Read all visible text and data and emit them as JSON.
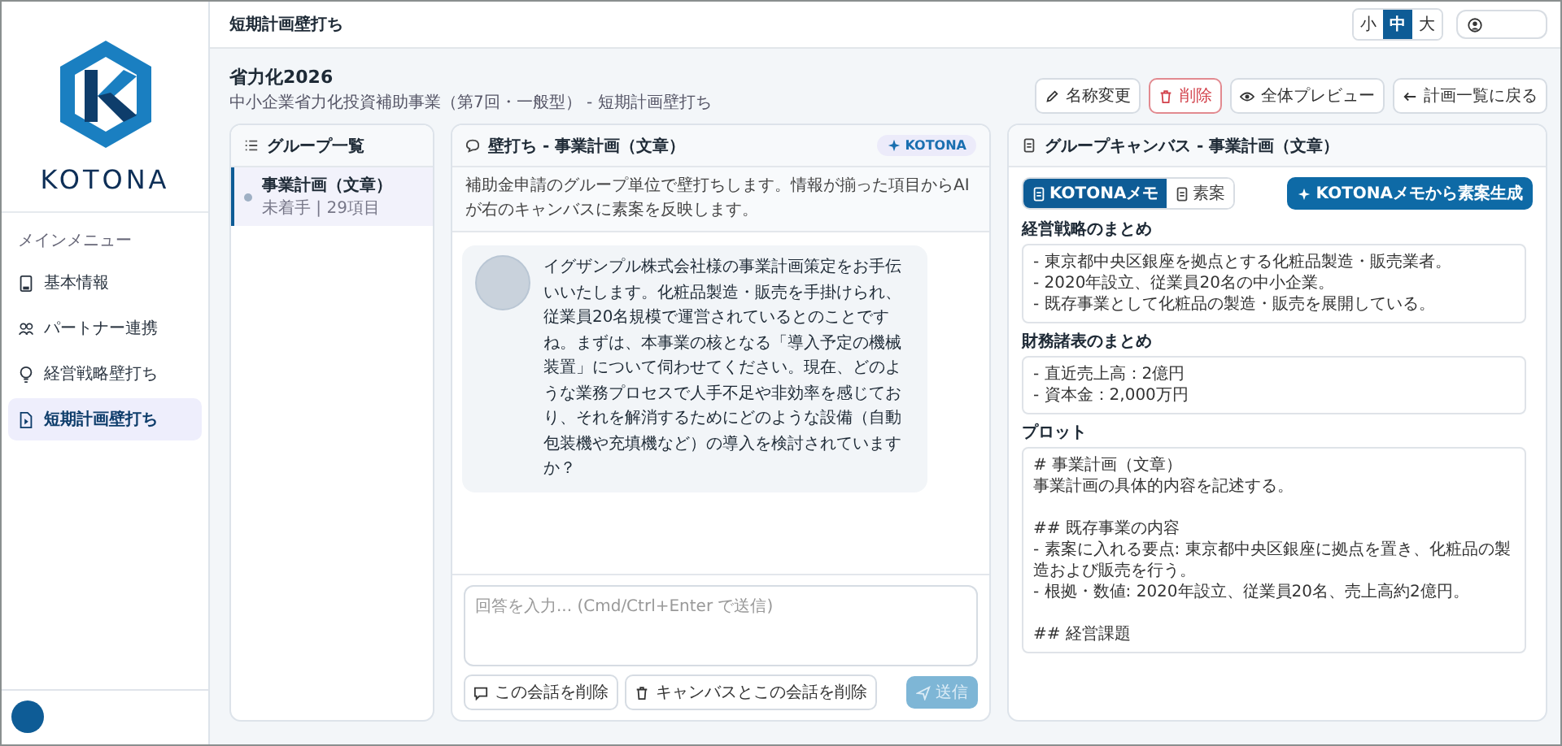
{
  "sidebar": {
    "logo_text": "KOTONA",
    "section_label": "メインメニュー",
    "items": [
      {
        "label": "基本情報",
        "selected": false
      },
      {
        "label": "パートナー連携",
        "selected": false
      },
      {
        "label": "経営戦略壁打ち",
        "selected": false
      },
      {
        "label": "短期計画壁打ち",
        "selected": true
      }
    ]
  },
  "topbar": {
    "title": "短期計画壁打ち",
    "font_sizes": [
      {
        "label": "小",
        "selected": false
      },
      {
        "label": "中",
        "selected": true
      },
      {
        "label": "大",
        "selected": false
      }
    ]
  },
  "page": {
    "title": "省力化2026",
    "subtitle": "中小企業省力化投資補助事業（第7回・一般型） - 短期計画壁打ち",
    "actions": [
      {
        "label": "名称変更",
        "kind": "edit"
      },
      {
        "label": "削除",
        "kind": "delete"
      },
      {
        "label": "全体プレビュー",
        "kind": "preview"
      },
      {
        "label": "計画一覧に戻る",
        "kind": "back"
      }
    ]
  },
  "groups": {
    "title": "グループ一覧",
    "items": [
      {
        "name": "事業計画（文章）",
        "meta": "未着手 | 29項目",
        "selected": true
      }
    ]
  },
  "chat": {
    "title": "壁打ち - 事業計画（文章）",
    "badge": "KOTONA",
    "description": "補助金申請のグループ単位で壁打ちします。情報が揃った項目からAIが右のキャンバスに素案を反映します。",
    "messages": [
      {
        "text": "イグザンプル株式会社様の事業計画策定をお手伝いいたします。化粧品製造・販売を手掛けられ、従業員20名規模で運営されているとのことですね。まずは、本事業の核となる「導入予定の機械装置」について伺わせてください。現在、どのような業務プロセスで人手不足や非効率を感じており、それを解消するためにどのような設備（自動包装機や充填機など）の導入を検討されていますか？"
      }
    ],
    "input": {
      "placeholder": "回答を入力... (Cmd/Ctrl+Enter で送信)"
    },
    "buttons": [
      {
        "label": "この会話を削除",
        "kind": "chat"
      },
      {
        "label": "キャンバスとこの会話を削除",
        "kind": "trash"
      }
    ],
    "send": {
      "label": "送信",
      "disabled": true
    }
  },
  "canvas": {
    "title": "グループキャンバス - 事業計画（文章）",
    "tabs": [
      {
        "label": "KOTONAメモ",
        "selected": true
      },
      {
        "label": "素案",
        "selected": false
      }
    ],
    "generate_button": "KOTONAメモから素案生成",
    "sections": [
      {
        "title": "経営戦略のまとめ",
        "paragraphs": [
          [
            "- 東京都中央区銀座を拠点とする化粧品製造・販売業者。",
            "- 2020年設立、従業員20名の中小企業。",
            "- 既存事業として化粧品の製造・販売を展開している。"
          ]
        ]
      },
      {
        "title": "財務諸表のまとめ",
        "paragraphs": [
          [
            "- 直近売上高：2億円",
            "- 資本金：2,000万円"
          ]
        ]
      },
      {
        "title": "プロット",
        "paragraphs": [
          [
            "# 事業計画（文章）",
            "事業計画の具体的内容を記述する。"
          ],
          [
            "## 既存事業の内容",
            "- 素案に入れる要点: 東京都中央区銀座に拠点を置き、化粧品の製造および販売を行う。",
            "- 根拠・数値: 2020年設立、従業員20名、売上高約2億円。"
          ],
          [
            "## 経営課題"
          ]
        ]
      }
    ]
  }
}
